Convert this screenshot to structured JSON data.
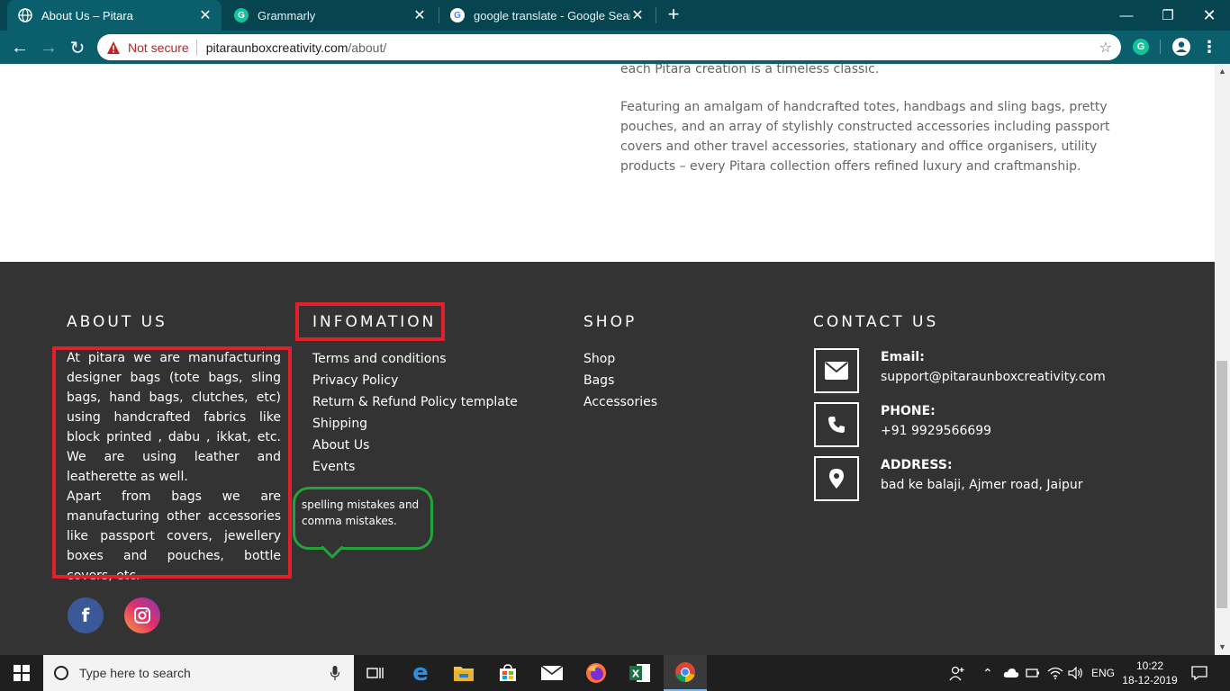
{
  "browser": {
    "tabs": [
      {
        "title": "About Us – Pitara",
        "active": true
      },
      {
        "title": "Grammarly",
        "active": false
      },
      {
        "title": "google translate - Google Search",
        "active": false
      }
    ],
    "security_label": "Not secure",
    "url_domain": "pitaraunboxcreativity.com",
    "url_path": "/about/"
  },
  "content": {
    "para_top": "each Pitara creation is a timeless classic.",
    "para_main": "Featuring an amalgam of handcrafted totes, handbags and sling bags, pretty pouches, and an array of stylishly constructed accessories including passport covers and other travel accessories, stationary and office organisers, utility products – every Pitara collection offers refined luxury and craftmanship."
  },
  "footer": {
    "about": {
      "heading": "ABOUT US",
      "text1": "At pitara we are manufacturing designer bags (tote bags, sling bags, hand bags, clutches, etc) using handcrafted fabrics like block printed , dabu , ikkat, etc. We are using leather and leatherette as well.",
      "text2": "Apart from bags we are manufacturing other accessories like passport covers, jewellery boxes and pouches, bottle covers, etc."
    },
    "information": {
      "heading": "INFOMATION",
      "links": [
        "Terms and conditions",
        "Privacy Policy",
        "Return & Refund Policy template",
        "Shipping",
        "About Us",
        "Events"
      ]
    },
    "annotation": "spelling mistakes and comma mistakes.",
    "shop": {
      "heading": "SHOP",
      "links": [
        "Shop",
        "Bags",
        "Accessories"
      ]
    },
    "contact": {
      "heading": "CONTACT US",
      "email_label": "Email:",
      "email": "support@pitaraunboxcreativity.com",
      "phone_label": "PHONE:",
      "phone": "+91 9929566699",
      "address_label": "ADDRESS:",
      "address": "bad ke balaji, Ajmer road, Jaipur"
    }
  },
  "taskbar": {
    "search_placeholder": "Type here to search",
    "language": "ENG",
    "time": "10:22",
    "date": "18-12-2019"
  },
  "colors": {
    "footer_bg": "#333333",
    "annotation_red": "#e0202b",
    "annotation_green": "#21a43a",
    "chrome_teal": "#0b5e6b"
  }
}
